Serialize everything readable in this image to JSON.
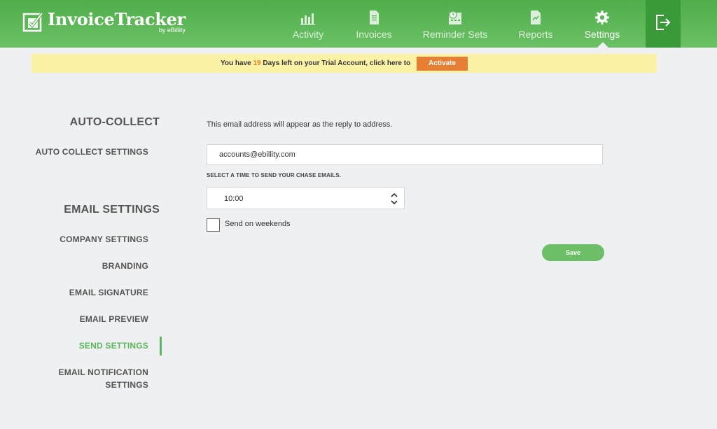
{
  "app": {
    "name": "InvoiceTracker",
    "byline": "by eBillity",
    "brand_color": "#5cb85c",
    "accent_color": "#e67e33"
  },
  "nav": {
    "items": [
      {
        "label": "Activity",
        "icon": "bar-chart-icon"
      },
      {
        "label": "Invoices",
        "icon": "document-icon"
      },
      {
        "label": "Reminder Sets",
        "icon": "calendar-clock-icon"
      },
      {
        "label": "Reports",
        "icon": "report-chart-icon"
      },
      {
        "label": "Settings",
        "icon": "gear-icon",
        "active": true
      }
    ],
    "logout_icon": "logout-icon"
  },
  "banner": {
    "prefix": "You have ",
    "days": "19",
    "suffix": " Days left on your Trial Account, click here to",
    "button": "Activate"
  },
  "sidebar": {
    "sections": [
      {
        "heading": "AUTO-COLLECT",
        "items": [
          {
            "label": "AUTO COLLECT SETTINGS"
          }
        ]
      },
      {
        "heading": "EMAIL SETTINGS",
        "items": [
          {
            "label": "COMPANY SETTINGS"
          },
          {
            "label": "BRANDING"
          },
          {
            "label": "EMAIL SIGNATURE"
          },
          {
            "label": "EMAIL PREVIEW"
          },
          {
            "label": "SEND SETTINGS",
            "active": true
          },
          {
            "label": "EMAIL NOTIFICATION SETTINGS",
            "lines": [
              "EMAIL NOTIFICATION",
              "SETTINGS"
            ]
          }
        ]
      }
    ]
  },
  "form": {
    "intro": "This email address will appear as the reply to address.",
    "email_value": "accounts@ebillity.com",
    "time_label": "SELECT A TIME TO SEND YOUR CHASE EMAILS.",
    "time_value": "10:00",
    "weekends_label": "Send on weekends",
    "weekends_checked": false,
    "save_label": "Save"
  }
}
